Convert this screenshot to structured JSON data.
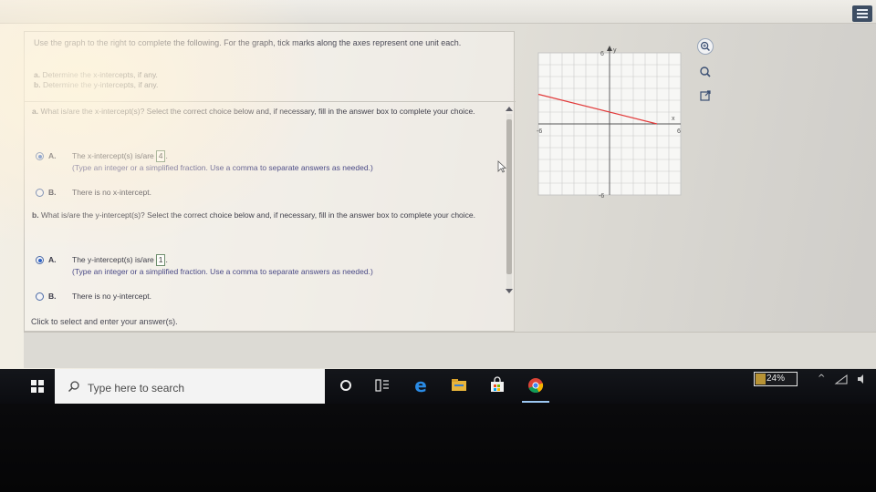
{
  "question": {
    "instructions": "Use the graph to the right to complete the following. For the graph, tick marks along the axes represent one unit each.",
    "part_a_label": "a.",
    "part_a_text": "Determine the x-intercepts, if any.",
    "part_b_label": "b.",
    "part_b_text": "Determine the y-intercepts, if any."
  },
  "section_a": {
    "prompt_label": "a.",
    "prompt": "What is/are the x-intercept(s)? Select the correct choice below and, if necessary, fill in the answer box to complete your choice.",
    "choice_a_letter": "A.",
    "choice_a_text": "The x-intercept(s) is/are",
    "choice_a_answer": "4",
    "choice_a_hint": "(Type an integer or a simplified fraction. Use a comma to separate answers as needed.)",
    "choice_b_letter": "B.",
    "choice_b_text": "There is no x-intercept."
  },
  "section_b": {
    "prompt_label": "b.",
    "prompt": "What is/are the y-intercept(s)? Select the correct choice below and, if necessary, fill in the answer box to complete your choice.",
    "choice_a_letter": "A.",
    "choice_a_text": "The y-intercept(s) is/are",
    "choice_a_answer": "1",
    "choice_a_hint": "(Type an integer or a simplified fraction. Use a comma to separate answers as needed.)",
    "choice_b_letter": "B.",
    "choice_b_text": "There is no y-intercept."
  },
  "status_text": "Click to select and enter your answer(s).",
  "graph": {
    "y_axis_label": "y",
    "x_axis_label": "x",
    "y_max_label": "6",
    "y_min_label": "-6",
    "x_min_label": "-6",
    "x_max_label": "6",
    "x_min": -6,
    "x_max": 6,
    "y_min": -6,
    "y_max": 6,
    "line_points": [
      [
        -6,
        2.5
      ],
      [
        4,
        0
      ]
    ],
    "line_color": "#e23a3a"
  },
  "taskbar": {
    "search_placeholder": "Type here to search",
    "battery_label": "24%",
    "battery_level": 0.24
  },
  "icons": {
    "zoom_in": "magnifier-plus-icon",
    "zoom_out": "magnifier-icon",
    "popout": "external-window-icon",
    "start": "windows-logo-icon",
    "search": "search-icon",
    "cortana": "cortana-circle-icon",
    "task_view": "task-view-icon",
    "edge": "edge-browser-icon",
    "explorer": "file-explorer-icon",
    "store": "store-bag-icon",
    "chrome": "chrome-icon"
  },
  "colors": {
    "radio_selected": "#2e63c6",
    "taskbar_bg": "#111216",
    "battery_fill": "#d5a83a"
  }
}
